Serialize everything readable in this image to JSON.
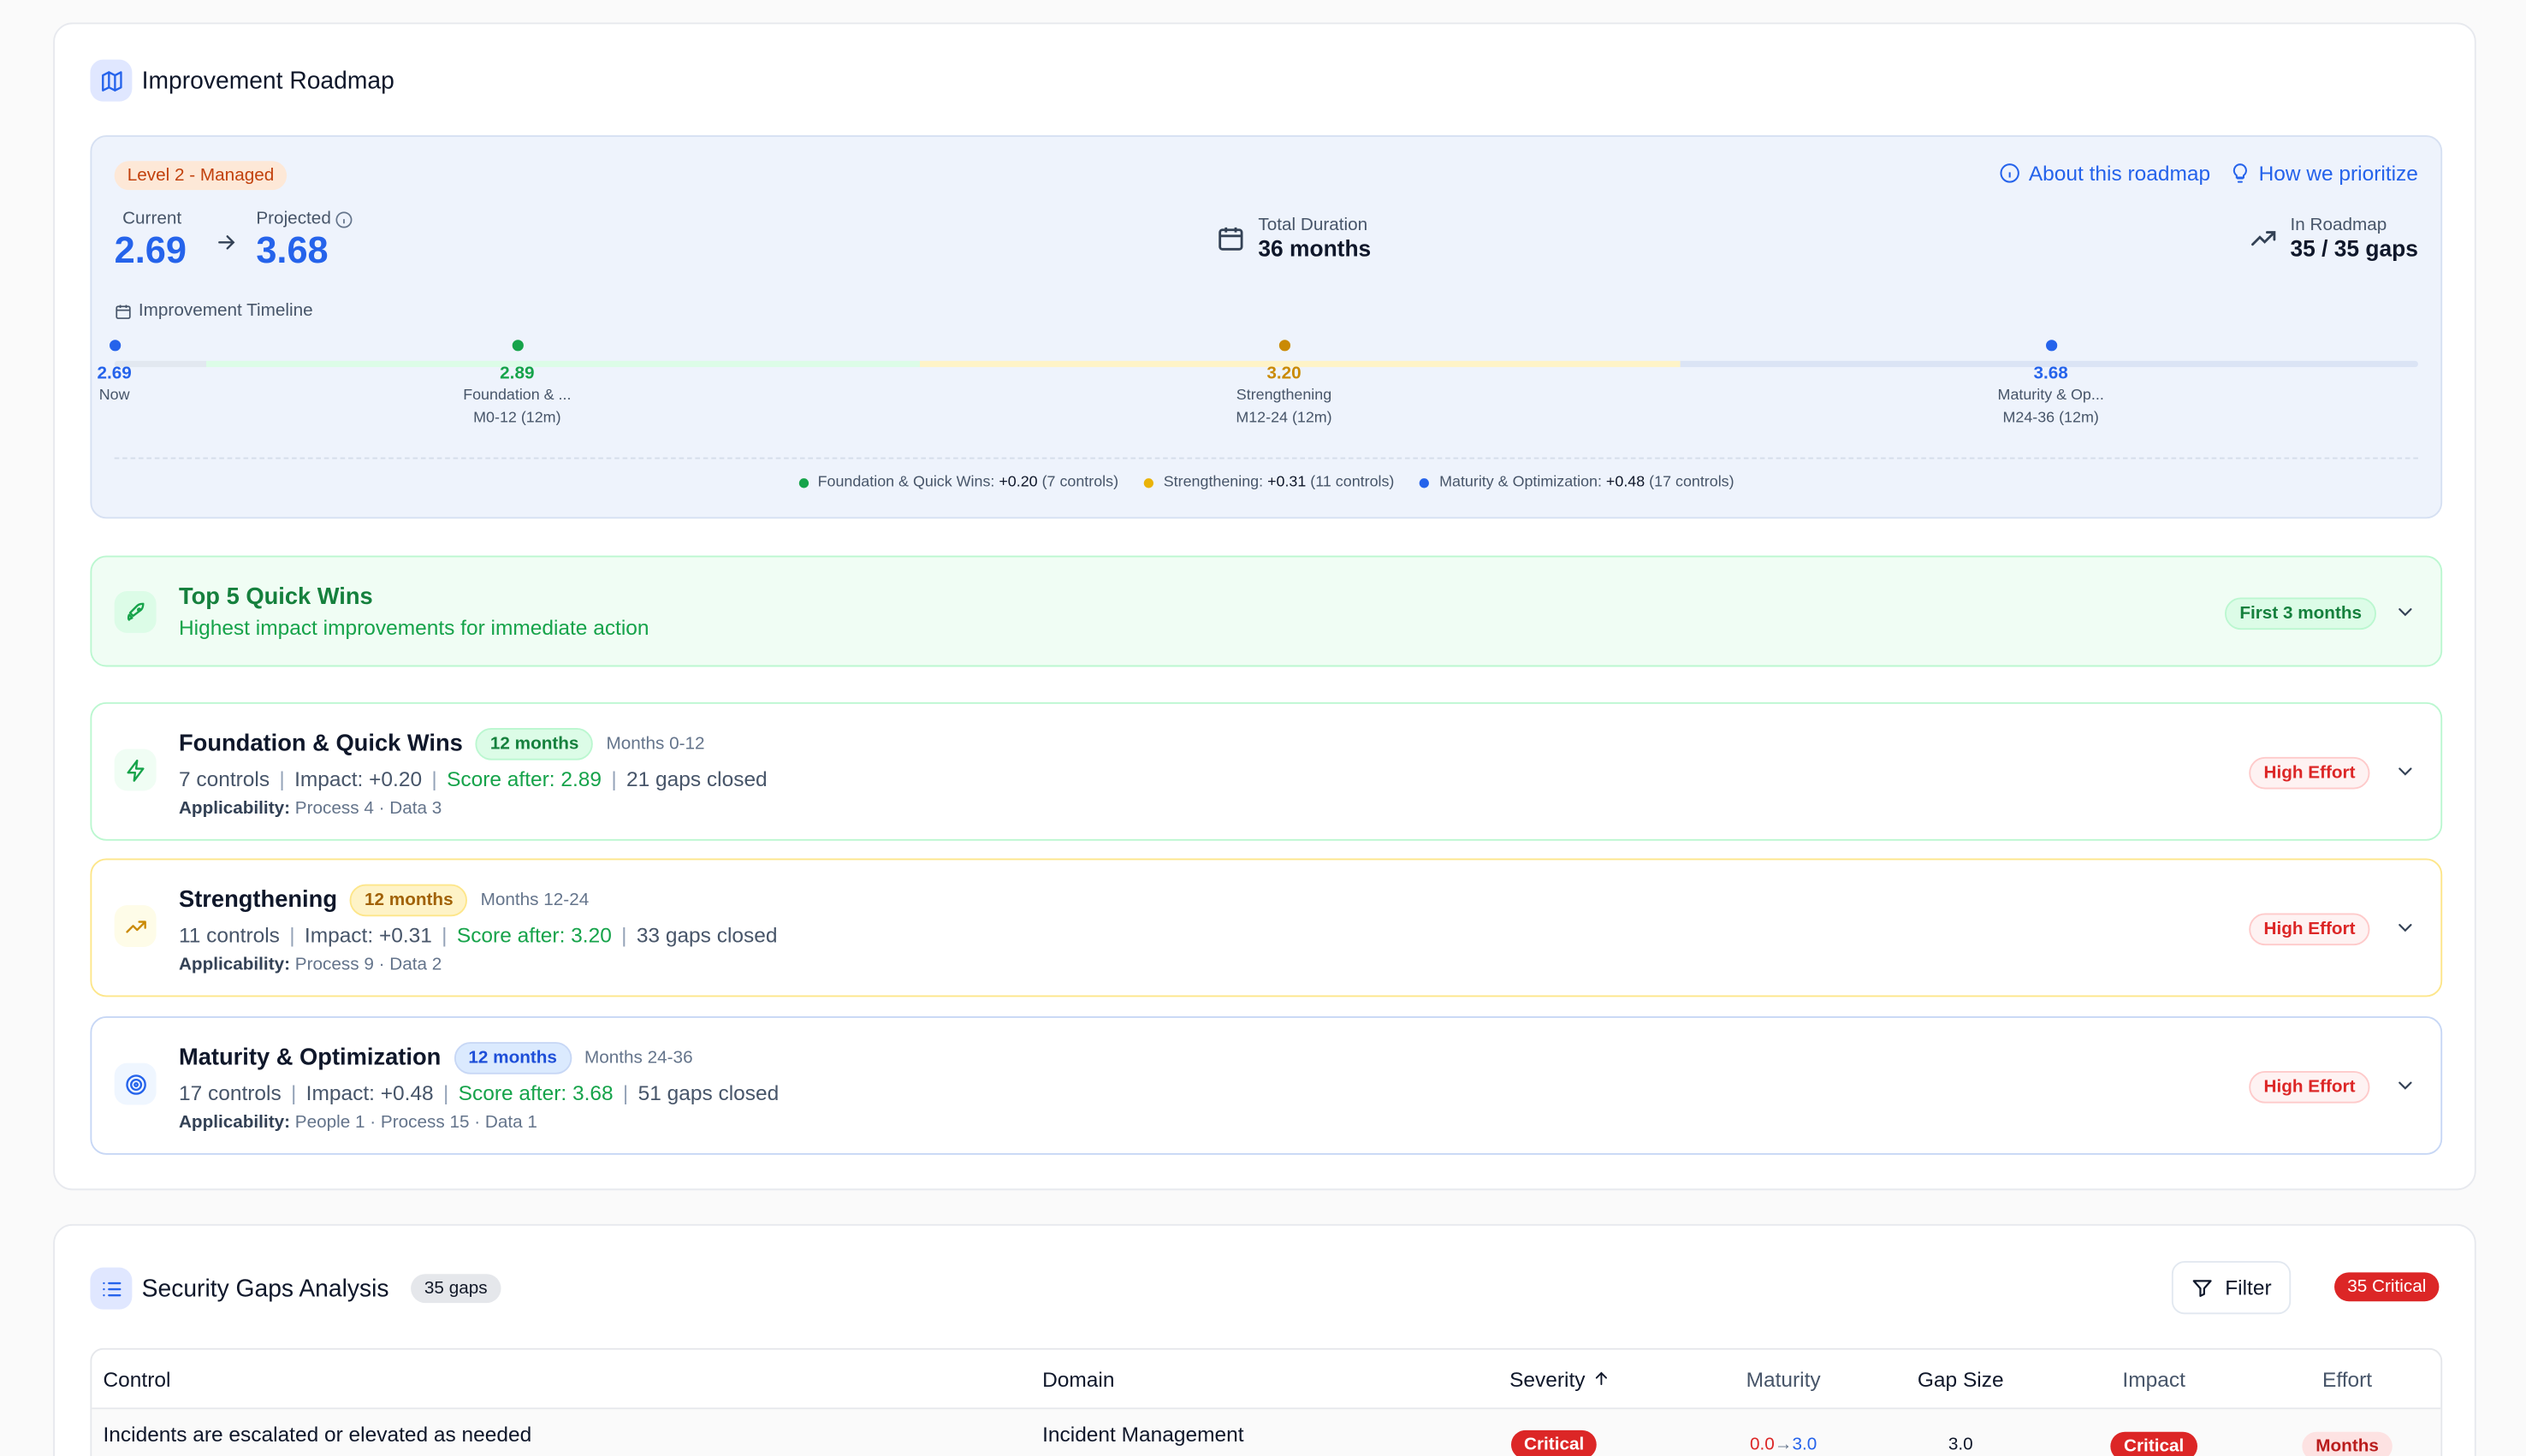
{
  "roadmap": {
    "title": "Improvement Roadmap",
    "level_badge": "Level 2 - Managed",
    "current_label": "Current",
    "current_value": "2.69",
    "projected_label": "Projected",
    "projected_value": "3.68",
    "about_link": "About this roadmap",
    "prioritize_link": "How we prioritize",
    "duration_label": "Total Duration",
    "duration_value": "36 months",
    "in_roadmap_label": "In Roadmap",
    "in_roadmap_value": "35 / 35 gaps",
    "timeline_label": "Improvement Timeline",
    "timeline": [
      {
        "score": "2.69",
        "name": "Now",
        "range": "",
        "color": "#2563eb"
      },
      {
        "score": "2.89",
        "name": "Foundation & ...",
        "range": "M0-12 (12m)",
        "color": "#16a34a"
      },
      {
        "score": "3.20",
        "name": "Strengthening",
        "range": "M12-24 (12m)",
        "color": "#ca8a04"
      },
      {
        "score": "3.68",
        "name": "Maturity & Op...",
        "range": "M24-36 (12m)",
        "color": "#2563eb"
      }
    ],
    "legend": [
      {
        "label": "Foundation & Quick Wins:",
        "value": "+0.20",
        "count": "(7 controls)",
        "color": "#16a34a"
      },
      {
        "label": "Strengthening:",
        "value": "+0.31",
        "count": "(11 controls)",
        "color": "#eab308"
      },
      {
        "label": "Maturity & Optimization:",
        "value": "+0.48",
        "count": "(17 controls)",
        "color": "#2563eb"
      }
    ]
  },
  "quick_wins": {
    "title": "Top 5 Quick Wins",
    "subtitle": "Highest impact improvements for immediate action",
    "badge": "First 3 months"
  },
  "phases": [
    {
      "title": "Foundation & Quick Wins",
      "duration": "12 months",
      "months": "Months 0-12",
      "controls": "7 controls",
      "impact": "Impact: +0.20",
      "score": "Score after: 2.89",
      "gaps": "21 gaps closed",
      "applicability_label": "Applicability:",
      "applicability": "Process 4 · Data 3",
      "effort": "High Effort"
    },
    {
      "title": "Strengthening",
      "duration": "12 months",
      "months": "Months 12-24",
      "controls": "11 controls",
      "impact": "Impact: +0.31",
      "score": "Score after: 3.20",
      "gaps": "33 gaps closed",
      "applicability_label": "Applicability:",
      "applicability": "Process 9 · Data 2",
      "effort": "High Effort"
    },
    {
      "title": "Maturity & Optimization",
      "duration": "12 months",
      "months": "Months 24-36",
      "controls": "17 controls",
      "impact": "Impact: +0.48",
      "score": "Score after: 3.68",
      "gaps": "51 gaps closed",
      "applicability_label": "Applicability:",
      "applicability": "People 1 · Process 15 · Data 1",
      "effort": "High Effort"
    }
  ],
  "gaps": {
    "title": "Security Gaps Analysis",
    "count_badge": "35 gaps",
    "filter_label": "Filter",
    "critical_badge": "35 Critical",
    "columns": [
      "Control",
      "Domain",
      "Severity",
      "Maturity",
      "Gap Size",
      "Impact",
      "Effort"
    ],
    "rows": [
      {
        "control": "Incidents are escalated or elevated as needed",
        "domain": "Incident Management",
        "severity": "Critical",
        "maturity_from": "0.0",
        "maturity_arrow": "→",
        "maturity_to": "3.0",
        "gap": "3.0",
        "impact": "Critical",
        "effort": "Months"
      }
    ]
  }
}
